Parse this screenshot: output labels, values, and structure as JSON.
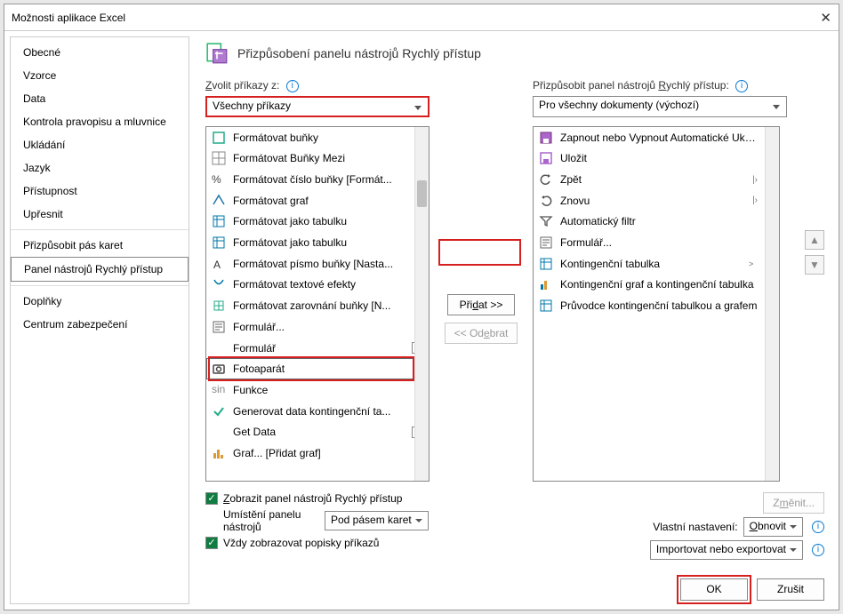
{
  "window": {
    "title": "Možnosti aplikace Excel",
    "close": "✕"
  },
  "sidebar": {
    "items": [
      {
        "label": "Obecné"
      },
      {
        "label": "Vzorce"
      },
      {
        "label": "Data"
      },
      {
        "label": "Kontrola pravopisu a mluvnice"
      },
      {
        "label": "Ukládání"
      },
      {
        "label": "Jazyk"
      },
      {
        "label": "Přístupnost"
      },
      {
        "label": "Upřesnit"
      }
    ],
    "items2": [
      {
        "label": "Přizpůsobit pás karet"
      },
      {
        "label": "Panel nástrojů Rychlý přístup",
        "selected": true
      }
    ],
    "items3": [
      {
        "label": "Doplňky"
      },
      {
        "label": "Centrum zabezpečení"
      }
    ]
  },
  "main": {
    "heading": "Přizpůsobení panelu nástrojů Rychlý přístup",
    "choose_label": "Zvolit příkazy z:",
    "choose_value": "Všechny příkazy",
    "customize_label": "Přizpůsobit panel nástrojů Rychlý přístup:",
    "customize_value": "Pro všechny dokumenty (výchozí)",
    "left_list": [
      {
        "label": "Formátovat buňky",
        "sub": ""
      },
      {
        "label": "Formátovat Buňky Mezi",
        "sub": ""
      },
      {
        "label": "Formátovat číslo buňky [Formát...",
        "sub": ""
      },
      {
        "label": "Formátovat graf",
        "sub": ""
      },
      {
        "label": "Formátovat jako tabulku",
        "sub": ">"
      },
      {
        "label": "Formátovat jako tabulku",
        "sub": ">"
      },
      {
        "label": "Formátovat písmo buňky [Nasta...",
        "sub": ""
      },
      {
        "label": "Formátovat textové efekty",
        "sub": ""
      },
      {
        "label": "Formátovat zarovnání buňky [N...",
        "sub": ""
      },
      {
        "label": "Formulář...",
        "sub": ""
      },
      {
        "label": "Formulář",
        "drop": true
      },
      {
        "label": "Fotoaparát",
        "sel": true
      },
      {
        "label": "Funkce",
        "sub": ">"
      },
      {
        "label": "Generovat data kontingenční ta...",
        "sub": ""
      },
      {
        "label": "Get Data",
        "drop": true
      },
      {
        "label": "Graf... [Přidat graf]",
        "sub": ""
      }
    ],
    "right_list": [
      {
        "label": "Zapnout nebo Vypnout Automatické Uklá..."
      },
      {
        "label": "Uložit"
      },
      {
        "label": "Zpět",
        "split": true
      },
      {
        "label": "Znovu",
        "split": true
      },
      {
        "label": "Automatický filtr"
      },
      {
        "label": "Formulář..."
      },
      {
        "label": "Kontingenční tabulka",
        "sub": ">"
      },
      {
        "label": "Kontingenční graf a kontingenční tabulka"
      },
      {
        "label": "Průvodce kontingenční tabulkou a grafem"
      }
    ],
    "add": "Přidat >>",
    "remove": "<< Odebrat",
    "show_qat": "Zobrazit panel nástrojů Rychlý přístup",
    "position_label": "Umístění panelu nástrojů",
    "position_value": "Pod pásem karet",
    "always_labels": "Vždy zobrazovat popisky příkazů",
    "modify": "Změnit...",
    "custom_label": "Vlastní nastavení:",
    "reset": "Obnovit",
    "import": "Importovat nebo exportovat",
    "ok": "OK",
    "cancel": "Zrušit"
  }
}
